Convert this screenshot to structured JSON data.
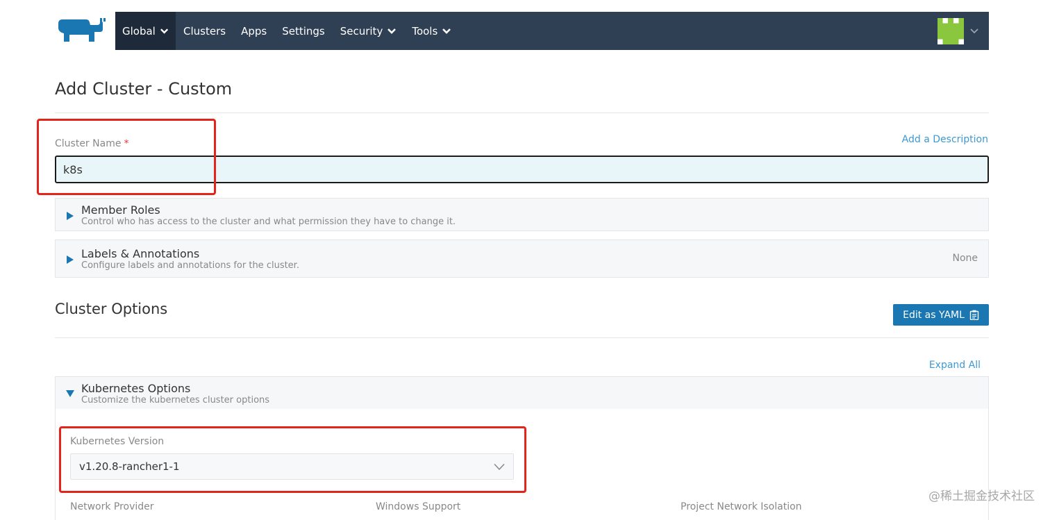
{
  "nav": {
    "items": [
      {
        "label": "Global",
        "has_dropdown": true,
        "active": true
      },
      {
        "label": "Clusters",
        "has_dropdown": false,
        "active": false
      },
      {
        "label": "Apps",
        "has_dropdown": false,
        "active": false
      },
      {
        "label": "Settings",
        "has_dropdown": false,
        "active": false
      },
      {
        "label": "Security",
        "has_dropdown": true,
        "active": false
      },
      {
        "label": "Tools",
        "has_dropdown": true,
        "active": false
      }
    ],
    "logo_icon": "rancher-logo-icon",
    "avatar_icon": "identicon-avatar-icon"
  },
  "page": {
    "title": "Add Cluster - Custom"
  },
  "cluster_name": {
    "label": "Cluster Name",
    "required_mark": "*",
    "value": "k8s",
    "add_description": "Add a Description"
  },
  "member_roles": {
    "title": "Member Roles",
    "subtitle": "Control who has access to the cluster and what permission they have to change it."
  },
  "labels_annotations": {
    "title": "Labels & Annotations",
    "subtitle": "Configure labels and annotations for the cluster.",
    "status": "None"
  },
  "cluster_options": {
    "title": "Cluster Options",
    "edit_yaml": "Edit as YAML",
    "expand_all": "Expand All"
  },
  "kubernetes_options": {
    "title": "Kubernetes Options",
    "subtitle": "Customize the kubernetes cluster options",
    "version_label": "Kubernetes Version",
    "version_value": "v1.20.8-rancher1-1",
    "network_provider_label": "Network Provider",
    "windows_support_label": "Windows Support",
    "project_network_isolation_label": "Project Network Isolation"
  },
  "watermark": "@稀土掘金技术社区",
  "colors": {
    "navbar": "#2f3f54",
    "navbar_active": "#1e2a39",
    "link": "#3d98d3",
    "primary_button": "#1a77b2",
    "highlight_box": "#e4241b",
    "input_bg": "#e9f6f9",
    "logo": "#1a77b2",
    "avatar_green": "#8bc63f"
  }
}
